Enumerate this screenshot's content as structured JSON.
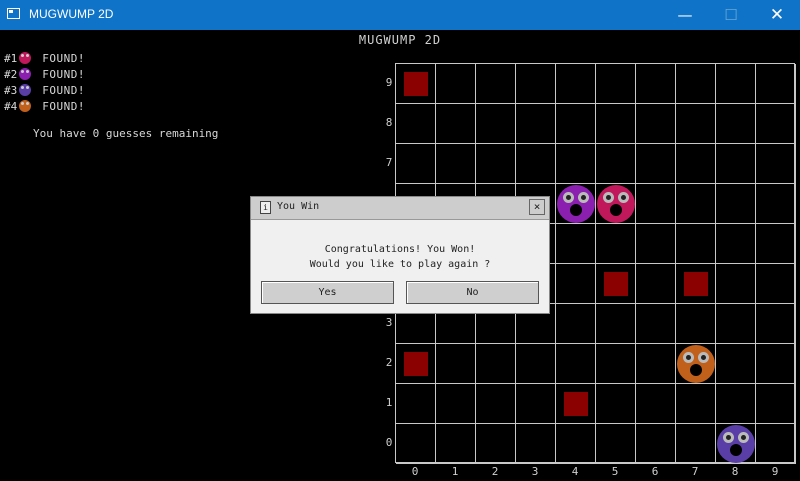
{
  "window": {
    "title": "MUGWUMP 2D",
    "minimize": "—",
    "maximize": "☐",
    "close": "✕"
  },
  "game": {
    "title": "MUGWUMP 2D",
    "status": [
      {
        "label": "#1",
        "status": "FOUND!",
        "color": "#c0185a"
      },
      {
        "label": "#2",
        "status": "FOUND!",
        "color": "#8a1fb0"
      },
      {
        "label": "#3",
        "status": "FOUND!",
        "color": "#5a3ea8"
      },
      {
        "label": "#4",
        "status": "FOUND!",
        "color": "#c0601a"
      }
    ],
    "guesses_text": "You have 0 guesses remaining",
    "x_labels": [
      "0",
      "1",
      "2",
      "3",
      "4",
      "5",
      "6",
      "7",
      "8",
      "9"
    ],
    "y_labels": [
      "9",
      "8",
      "7",
      "3",
      "2",
      "1",
      "0"
    ],
    "guess_markers": [
      {
        "x": 0,
        "y": 9
      },
      {
        "x": 5,
        "y": 4
      },
      {
        "x": 7,
        "y": 4
      },
      {
        "x": 0,
        "y": 2
      },
      {
        "x": 4,
        "y": 1
      }
    ],
    "mugwumps": [
      {
        "x": 4,
        "y": 6,
        "color": "#8a1fb0"
      },
      {
        "x": 5,
        "y": 6,
        "color": "#c0185a"
      },
      {
        "x": 7,
        "y": 2,
        "color": "#c0601a"
      },
      {
        "x": 8,
        "y": 0,
        "color": "#5a3ea8"
      }
    ]
  },
  "dialog": {
    "title": "You Win",
    "close": "×",
    "icon": "i",
    "line1": "Congratulations! You Won!",
    "line2": "Would you like to play again ?",
    "yes": "Yes",
    "no": "No"
  }
}
